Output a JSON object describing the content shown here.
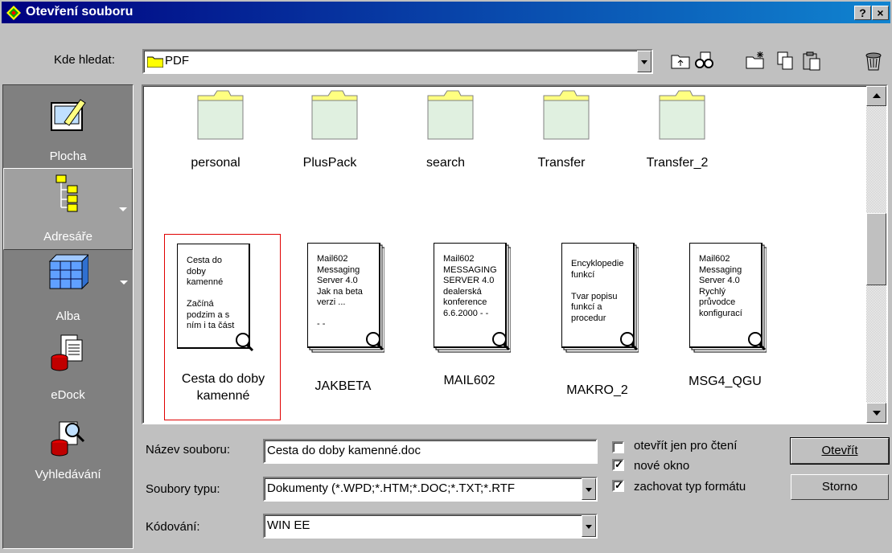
{
  "window": {
    "title": "Otevření souboru",
    "help_btn": "?",
    "close_btn": "×"
  },
  "look_in": {
    "label": "Kde hledat:",
    "value": "PDF"
  },
  "toolbar": {
    "icons": [
      "up-folder-icon",
      "preview-icon",
      "new-folder-icon",
      "copy-icon",
      "paste-icon",
      "delete-icon"
    ]
  },
  "sidebar": {
    "items": [
      {
        "label": "Plocha"
      },
      {
        "label": "Adresáře"
      },
      {
        "label": "Alba"
      },
      {
        "label": "eDock"
      },
      {
        "label": "Vyhledávání"
      }
    ]
  },
  "folders": [
    "personal",
    "PlusPack",
    "search",
    "Transfer",
    "Transfer_2"
  ],
  "documents": [
    {
      "name": "Cesta do doby",
      "name2": "kamenné",
      "preview": [
        "Cesta do",
        "doby",
        "kamenné",
        "",
        "Začíná",
        "podzim a s",
        "ním i ta část"
      ]
    },
    {
      "name": "JAKBETA",
      "preview": [
        "Mail602",
        "Messaging",
        "Server 4.0",
        "Jak na beta",
        "verzi ...",
        "",
        "- -"
      ]
    },
    {
      "name": "MAIL602",
      "preview": [
        "Mail602",
        "MESSAGING",
        "SERVER 4.0",
        "dealerská",
        "konference",
        "6.6.2000 - -"
      ]
    },
    {
      "name": "MAKRO_2",
      "preview": [
        "",
        "Encyklopedie",
        "funkcí",
        "",
        "Tvar popisu",
        "funkcí a",
        "procedur"
      ]
    },
    {
      "name": "MSG4_QGU",
      "preview": [
        "Mail602",
        "Messaging",
        "Server 4.0",
        "Rychlý",
        "průvodce",
        "konfigurací"
      ]
    }
  ],
  "form": {
    "filename_label": "Název souboru:",
    "filename_value": "Cesta do doby kamenné.doc",
    "filetype_label": "Soubory typu:",
    "filetype_value": "Dokumenty (*.WPD;*.HTM;*.DOC;*.TXT;*.RTF",
    "encoding_label": "Kódování:",
    "encoding_value": "WIN EE"
  },
  "options": [
    {
      "label": "otevřít jen pro čtení",
      "checked": false
    },
    {
      "label": "nové okno",
      "checked": true
    },
    {
      "label": "zachovat typ formátu",
      "checked": true
    }
  ],
  "buttons": {
    "open": "Otevřít",
    "cancel": "Storno"
  }
}
